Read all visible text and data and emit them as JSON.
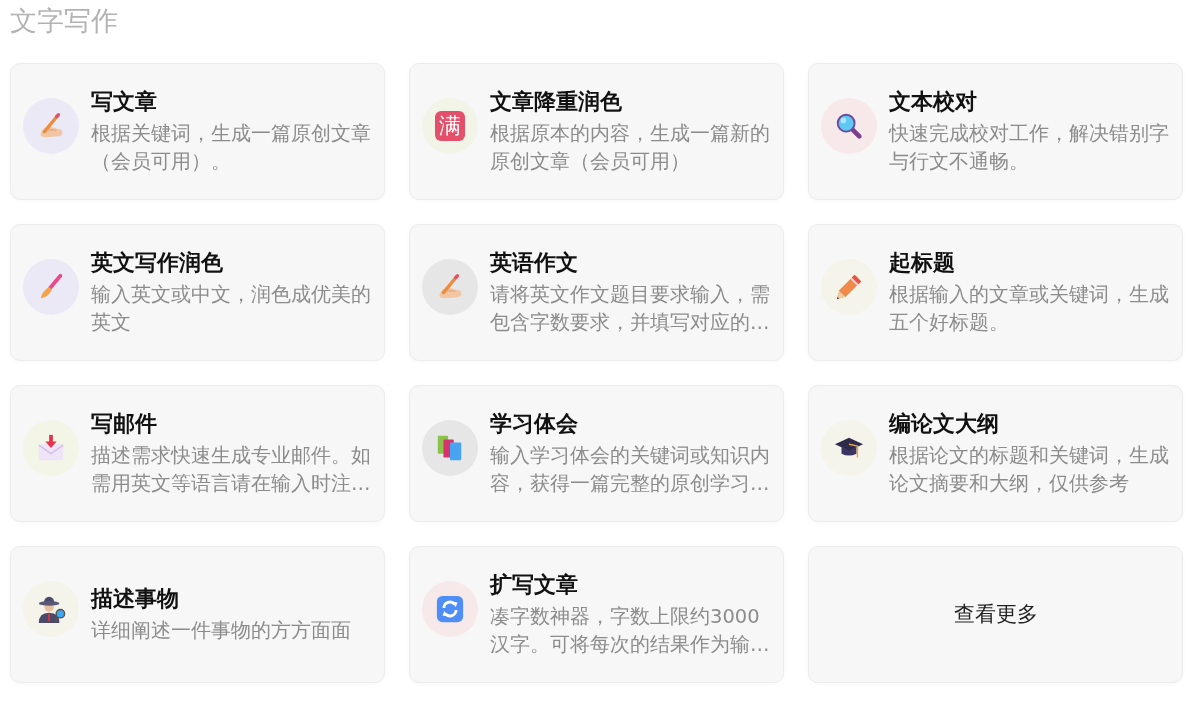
{
  "section_title": "文字写作",
  "cards": [
    {
      "title": "写文章",
      "description": "根据关键词，生成一篇原创文章（会员可用）。",
      "color": "#ebe9f6"
    },
    {
      "title": "文章降重润色",
      "description": "根据原本的内容，生成一篇新的原创文章（会员可用）",
      "color": "#f3f4e8",
      "icon_text": "满"
    },
    {
      "title": "文本校对",
      "description": "快速完成校对工作，解决错别字与行文不通畅。",
      "color": "#f7e9ea"
    },
    {
      "title": "英文写作润色",
      "description": "输入英文或中文，润色成优美的英文",
      "color": "#ebe9f6"
    },
    {
      "title": "英语作文",
      "description": "请将英文作文题目要求输入，需包含字数要求，并填写对应的…",
      "color": "#e6e6e6"
    },
    {
      "title": "起标题",
      "description": "根据输入的文章或关键词，生成五个好标题。",
      "color": "#f5f4ea"
    },
    {
      "title": "写邮件",
      "description": "描述需求快速生成专业邮件。如需用英文等语言请在输入时注…",
      "color": "#f3f5e6"
    },
    {
      "title": "学习体会",
      "description": "输入学习体会的关键词或知识内容，获得一篇完整的原创学习…",
      "color": "#e6e6e6"
    },
    {
      "title": "编论文大纲",
      "description": "根据论文的标题和关键词，生成论文摘要和大纲，仅供参考",
      "color": "#f5f4ea"
    },
    {
      "title": "描述事物",
      "description": "详细阐述一件事物的方方面面",
      "color": "#f5f4ea"
    },
    {
      "title": "扩写文章",
      "description": "凑字数神器，字数上限约3000汉字。可将每次的结果作为输…",
      "color": "#f7e9ea"
    }
  ],
  "more_button": {
    "label": "查看更多"
  }
}
